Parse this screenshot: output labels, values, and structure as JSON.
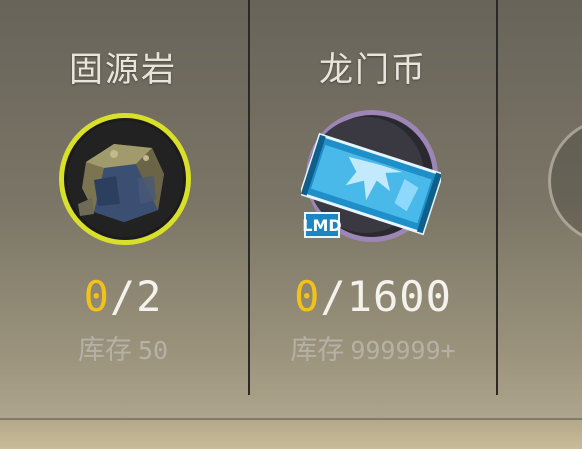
{
  "items": [
    {
      "name": "固源岩",
      "have": "0",
      "need": "/2",
      "stock_label": "库存",
      "stock_value": "50",
      "ring_color": "#d9e02a",
      "icon": "rock-icon"
    },
    {
      "name": "龙门币",
      "have": "0",
      "need": "/1600",
      "stock_label": "库存",
      "stock_value": "999999+",
      "ring_color": "#9d86b6",
      "icon": "lmd-ticket-icon"
    }
  ]
}
